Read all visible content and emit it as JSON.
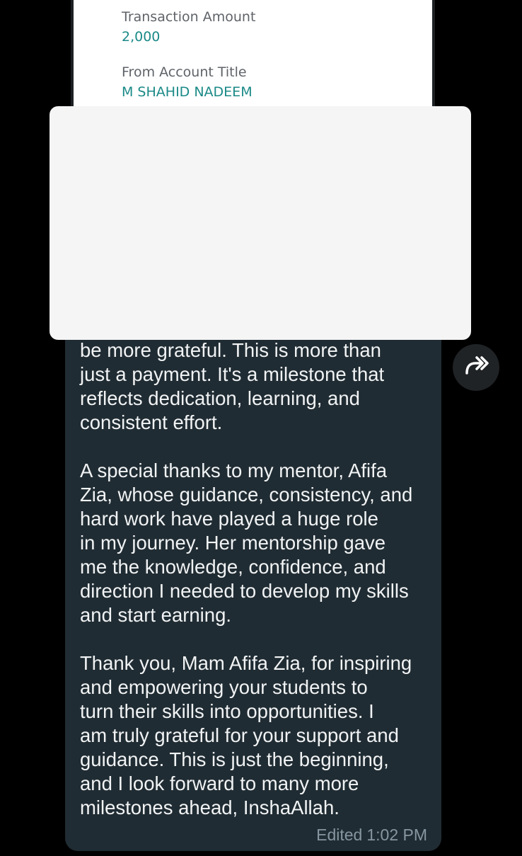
{
  "receipt": {
    "amount_label": "Transaction Amount",
    "amount_value": "2,000",
    "from_label": "From Account Title",
    "from_value": "M SHAHID NADEEM"
  },
  "message": {
    "paragraphs": [
      "be more grateful. This is more than\njust a payment. It's a milestone that\nreflects dedication, learning, and\nconsistent effort.",
      "A special thanks to my mentor, Afifa\nZia, whose guidance, consistency, and\nhard work have played a huge role\nin my journey. Her mentorship gave\nme the knowledge, confidence, and\ndirection I needed to develop my skills\nand start earning.",
      "Thank you, Mam Afifa Zia, for inspiring\nand empowering your students to\nturn their skills into opportunities. I\nam truly grateful for your support and\nguidance. This is just the beginning,\nand I look forward to many more\nmilestones ahead, InshaAllah."
    ],
    "edited_label": "Edited",
    "time": "1:02 PM"
  },
  "actions": {
    "forward_icon": "forward-icon"
  },
  "colors": {
    "background": "#000000",
    "bubble": "#202c33",
    "message_text": "#f1f3f4",
    "meta_text": "#8696a0",
    "receipt_value": "#1a8a87"
  }
}
